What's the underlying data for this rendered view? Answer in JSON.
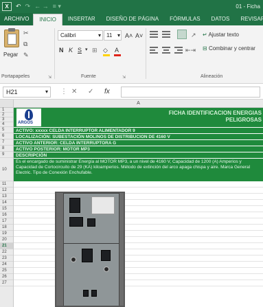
{
  "quick_access": {
    "app_icon": "excel-icon",
    "undo": "↶",
    "redo": "↷",
    "arrows": "← →",
    "more": "≡ ▾"
  },
  "window": {
    "title": "01 - Ficha"
  },
  "ribbon": {
    "tabs": [
      {
        "label": "ARCHIVO"
      },
      {
        "label": "INICIO"
      },
      {
        "label": "INSERTAR"
      },
      {
        "label": "DISEÑO DE PÁGINA"
      },
      {
        "label": "FÓRMULAS"
      },
      {
        "label": "DATOS"
      },
      {
        "label": "REVISAR"
      }
    ],
    "clipboard": {
      "paste_label": "Pegar",
      "group_label": "Portapapeles"
    },
    "font": {
      "name": "Calibri",
      "size": "11",
      "group_label": "Fuente",
      "bold": "N",
      "italic": "K",
      "underline": "S",
      "grow": "A˄",
      "shrink": "A˅",
      "fill_color": "#ffd200",
      "font_color": "#e0241a"
    },
    "alignment": {
      "wrap_text": "Ajustar texto",
      "merge_center": "Combinar y centrar",
      "group_label": "Alineación"
    }
  },
  "formula_bar": {
    "name_box": "H21",
    "cancel": "✕",
    "enter": "✓",
    "fx": "fx"
  },
  "sheet": {
    "column_header": "A",
    "row_numbers": [
      "1",
      "2",
      "3",
      "4",
      "5",
      "6",
      "7",
      "8",
      "9",
      "10",
      "11",
      "12",
      "13",
      "14",
      "15",
      "16",
      "17",
      "18",
      "19",
      "20",
      "21",
      "22",
      "23",
      "24",
      "25",
      "26",
      "27"
    ],
    "selected_row": "21",
    "logo_text": "ARGOS",
    "title_line1": "FICHA IDENTIFICACION ENERGIAS",
    "title_line2": "PELIGROSAS",
    "activo": "ACTIVO: xxxxx CELDA INTERRUPTOR ALIMENTADOR 9",
    "localizacion": "LOCALIZACIÓN: SUBESTACIÓN MOLINOS DE DISTRIBUCION DE 4160 V",
    "activo_anterior": "ACTIVO ANTERIOR: CELDA INTERRUPTORA G",
    "activo_posterior": "ACTIVO POSTERIOR: MOTOR MP3",
    "descripcion_label": "DESCRIPCIÓN",
    "descripcion_text": "Es el encargado de suministrar Energía al MOTOR MP3, a un nivel de 4160 V, Capacidad de 1200 (A) Amperios y Capacidad de Cortocircuito de 29 (KA) kiloamperios. Método de extinción del arco apaga chispa y aire. Marca General Electric. Tipo de Conexión Enchufable."
  },
  "colors": {
    "excel_green": "#217346",
    "sheet_green": "#1f8a3c",
    "argos_blue": "#1b3f8f"
  }
}
